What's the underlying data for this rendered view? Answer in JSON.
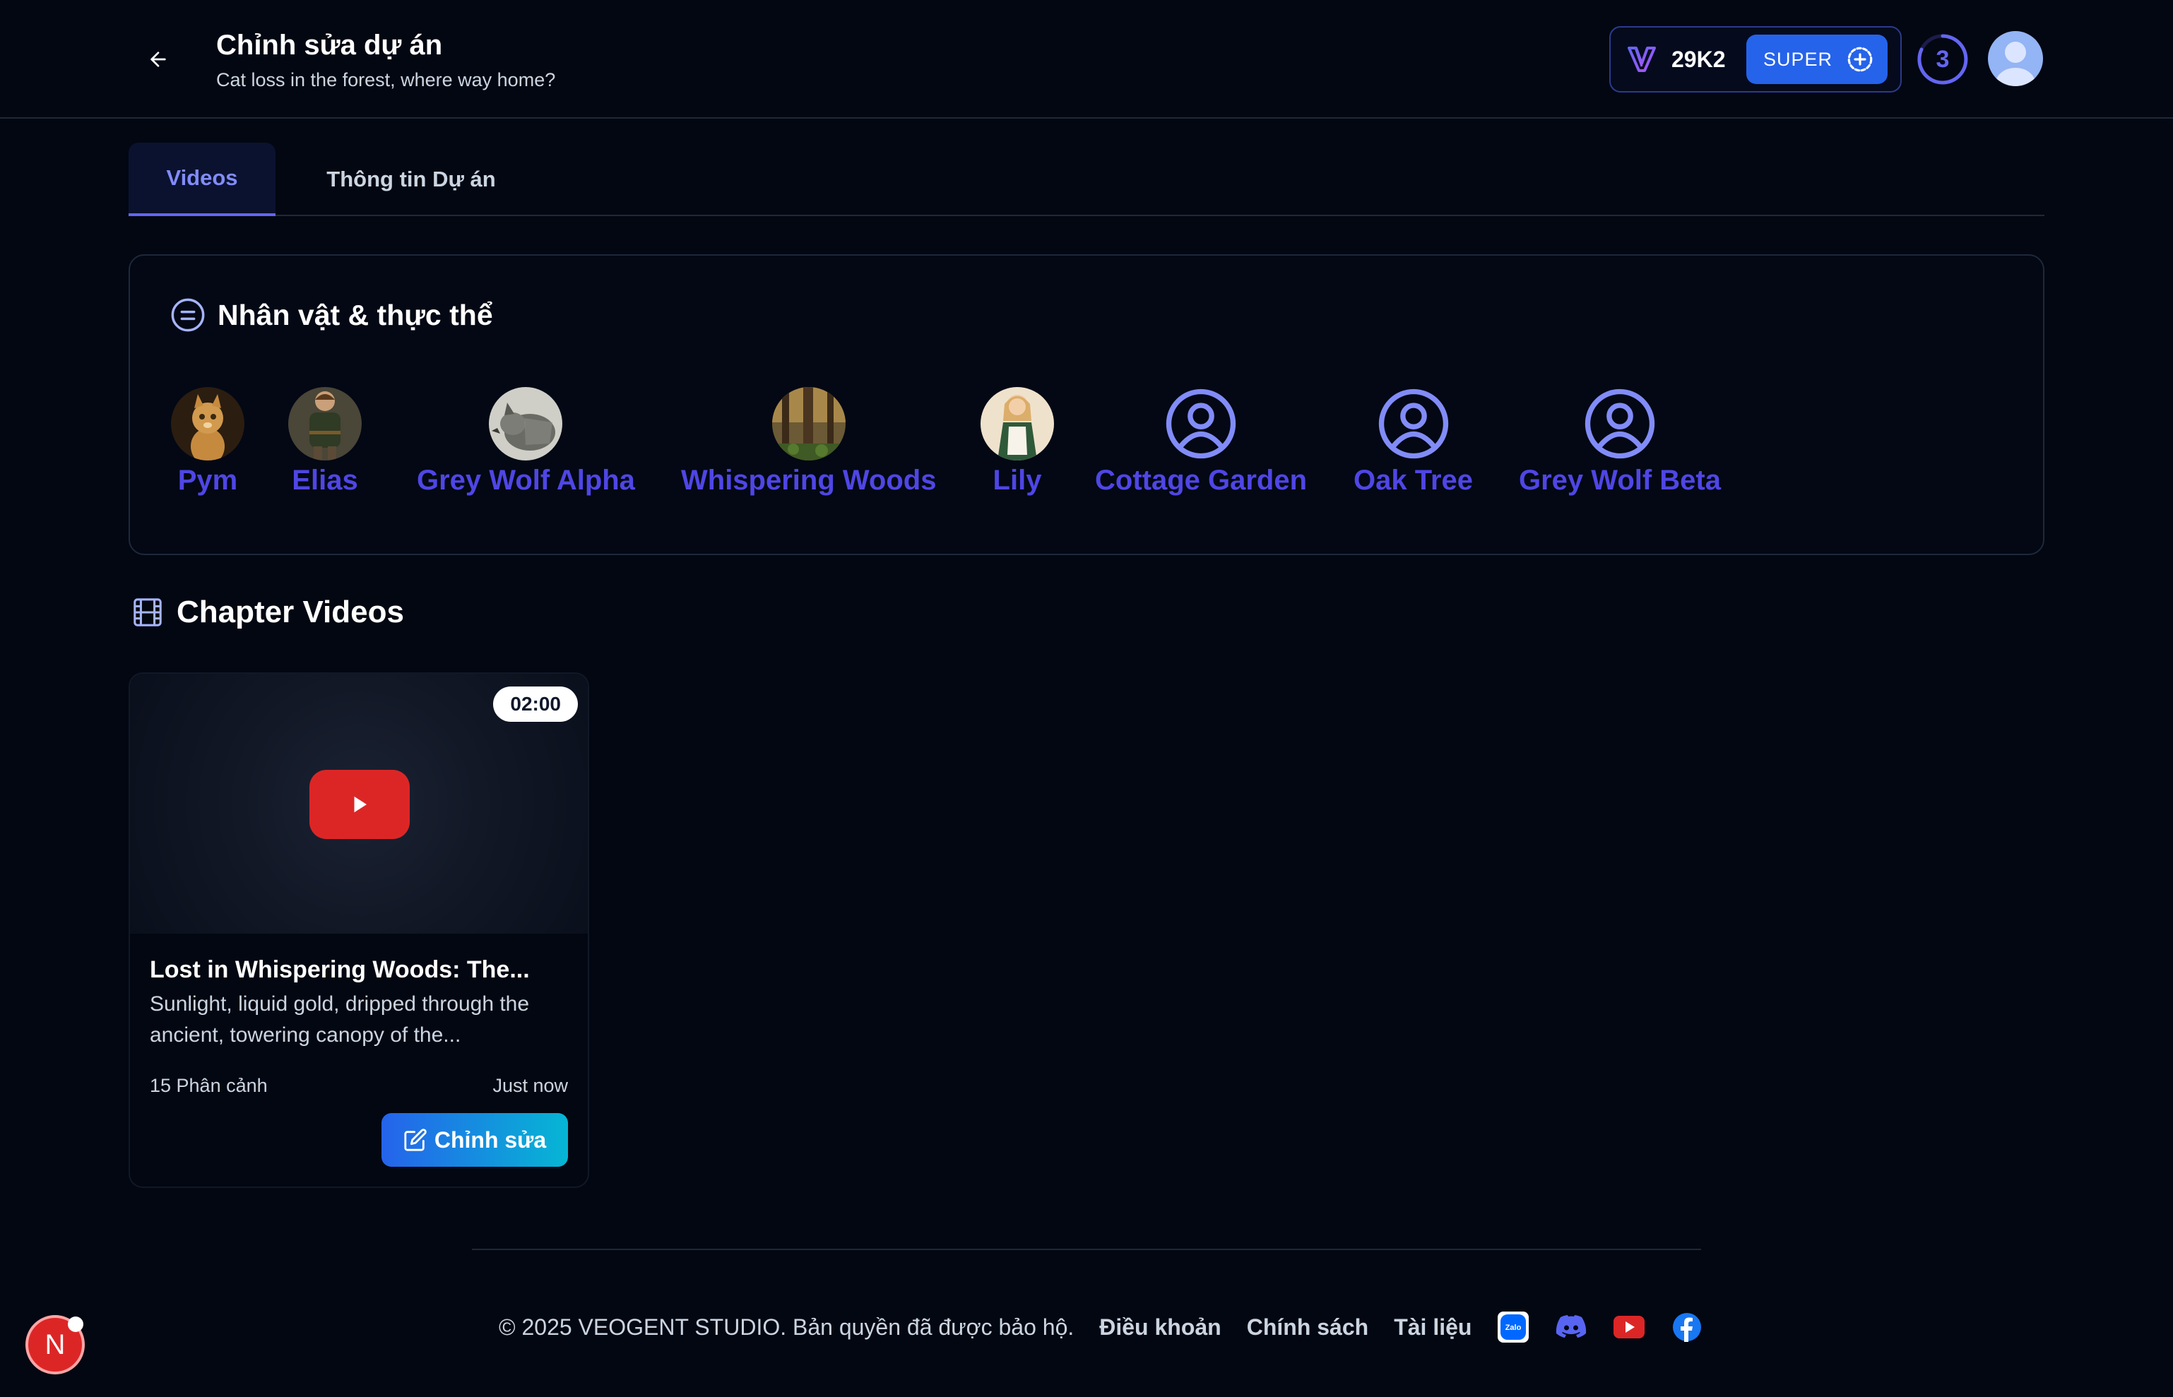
{
  "header": {
    "title": "Chỉnh sửa dự án",
    "subtitle": "Cat loss in the forest, where way home?",
    "credits": "29K2",
    "super_label": "SUPER",
    "notification_count": "3"
  },
  "tabs": [
    {
      "label": "Videos",
      "active": true
    },
    {
      "label": "Thông tin Dự án",
      "active": false
    }
  ],
  "characters": {
    "title": "Nhân vật & thực thể",
    "items": [
      {
        "name": "Pym",
        "icon": "cat-portrait"
      },
      {
        "name": "Elias",
        "icon": "boy-portrait"
      },
      {
        "name": "Grey Wolf Alpha",
        "icon": "wolf-portrait"
      },
      {
        "name": "Whispering Woods",
        "icon": "forest-portrait"
      },
      {
        "name": "Lily",
        "icon": "girl-portrait"
      },
      {
        "name": "Cottage Garden",
        "icon": "user-circle-icon"
      },
      {
        "name": "Oak Tree",
        "icon": "user-circle-icon"
      },
      {
        "name": "Grey Wolf Beta",
        "icon": "user-circle-icon"
      }
    ]
  },
  "chapter_videos": {
    "title": "Chapter Videos",
    "videos": [
      {
        "duration": "02:00",
        "title": "Lost in Whispering Woods: The...",
        "description": "Sunlight, liquid gold, dripped through the ancient, towering canopy of the...",
        "scenes": "15 Phân cảnh",
        "time": "Just now",
        "edit_label": "Chỉnh sửa"
      }
    ]
  },
  "footer": {
    "copyright": "© 2025 VEOGENT STUDIO. Bản quyền đã được bảo hộ.",
    "links": [
      "Điều khoản",
      "Chính sách",
      "Tài liệu"
    ],
    "zalo_label": "Zalo"
  },
  "dev_badge": "N",
  "colors": {
    "accent": "#6366f1",
    "character_name": "#4f46e5",
    "play_button": "#dc2626",
    "super_button": "#2563eb",
    "background": "#030712"
  }
}
